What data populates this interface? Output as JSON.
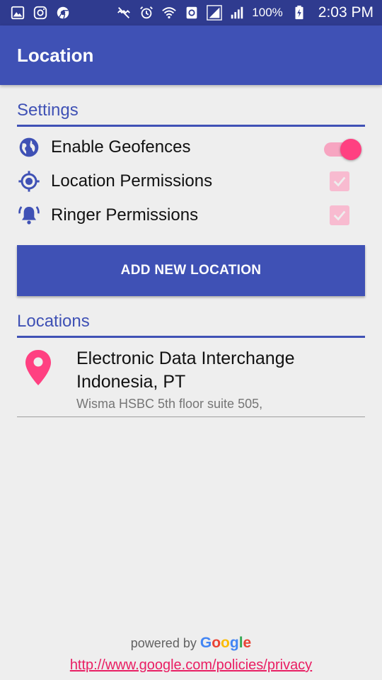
{
  "status_bar": {
    "battery": "100%",
    "time": "2:03 PM",
    "left_icons": [
      "gallery-icon",
      "instagram-icon",
      "chrome-icon"
    ],
    "right_icons": [
      "mute-icon",
      "alarm-icon",
      "wifi-icon",
      "data-saver-icon",
      "signal-icon",
      "signal-2-icon",
      "battery-charging-icon"
    ]
  },
  "app_bar": {
    "title": "Location"
  },
  "settings": {
    "header": "Settings",
    "enable_geofences": {
      "label": "Enable Geofences",
      "checked": true,
      "icon": "globe-icon"
    },
    "location_permissions": {
      "label": "Location Permissions",
      "checked": true,
      "icon": "gps-target-icon"
    },
    "ringer_permissions": {
      "label": "Ringer Permissions",
      "checked": true,
      "icon": "ringing-bell-icon"
    }
  },
  "add_button": {
    "label": "ADD NEW LOCATION"
  },
  "locations": {
    "header": "Locations",
    "items": [
      {
        "name": "Electronic Data Interchange Indonesia, PT",
        "address": "Wisma HSBC 5th floor suite 505,",
        "icon": "map-pin-icon"
      }
    ]
  },
  "footer": {
    "powered_by": "powered by",
    "google": [
      "G",
      "o",
      "o",
      "g",
      "l",
      "e"
    ],
    "privacy_link": "http://www.google.com/policies/privacy"
  },
  "colors": {
    "primary": "#3f51b5",
    "primary_dark": "#2f3b8f",
    "accent": "#ff4081",
    "background": "#eeeeee"
  }
}
